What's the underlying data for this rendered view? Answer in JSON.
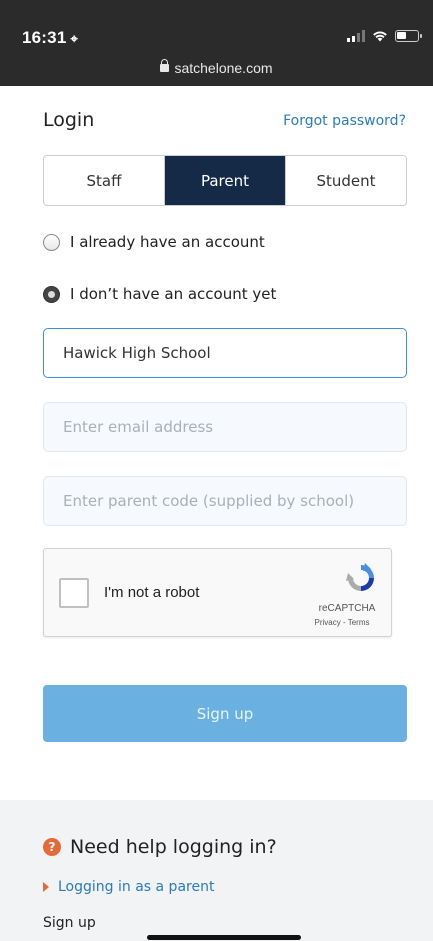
{
  "status_bar": {
    "time": "16:31",
    "location_glyph": "⌖",
    "url": "satchelone.com"
  },
  "login": {
    "title": "Login",
    "forgot_password": "Forgot password?",
    "tabs": [
      {
        "label": "Staff",
        "active": false
      },
      {
        "label": "Parent",
        "active": true
      },
      {
        "label": "Student",
        "active": false
      }
    ],
    "radios": [
      {
        "label": "I already have an account",
        "checked": false
      },
      {
        "label": "I don’t have an account yet",
        "checked": true
      }
    ],
    "school_field": {
      "value": "Hawick High School"
    },
    "email_field": {
      "placeholder": "Enter email address"
    },
    "parent_code_field": {
      "placeholder": "Enter parent code (supplied by school)"
    },
    "recaptcha": {
      "label": "I'm not a robot",
      "brand": "reCAPTCHA",
      "terms": "Privacy - Terms"
    },
    "signup_button": "Sign up"
  },
  "help": {
    "title": "Need help logging in?",
    "link": "Logging in as a parent",
    "signup": "Sign up"
  },
  "colors": {
    "active_tab": "#152a47",
    "link": "#2a7bbf",
    "signup_button": "#6ab1e2",
    "help_accent": "#e56a3a"
  }
}
